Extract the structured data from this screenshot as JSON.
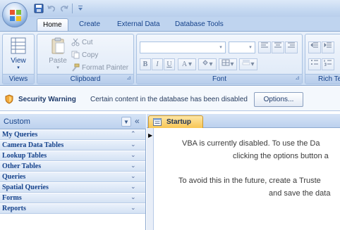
{
  "ribbon_tabs": [
    "Home",
    "Create",
    "External Data",
    "Database Tools"
  ],
  "ribbon_groups": {
    "views": {
      "label": "Views",
      "view_btn": "View"
    },
    "clipboard": {
      "label": "Clipboard",
      "paste": "Paste",
      "cut": "Cut",
      "copy": "Copy",
      "format_painter": "Format Painter"
    },
    "font": {
      "label": "Font"
    },
    "rich_text": {
      "label": "Rich Te"
    }
  },
  "security_bar": {
    "title": "Security Warning",
    "message": "Certain content in the database has been disabled",
    "options_button": "Options..."
  },
  "nav_pane": {
    "title": "Custom",
    "groups": [
      "My Queries",
      "Camera Data Tables",
      "Lookup Tables",
      "Other Tables",
      "Queries",
      "Spatial Queries",
      "Forms",
      "Reports"
    ]
  },
  "document": {
    "tab_label": "Startup",
    "lines": [
      "VBA is currently disabled.  To use the Da",
      "clicking the options button a",
      "To avoid this in the future, create a Truste",
      "and save the data"
    ]
  },
  "colors": {
    "accent": "#15428b",
    "active_doc_tab": "#f8c654",
    "ribbon": "#d8e5f6"
  }
}
